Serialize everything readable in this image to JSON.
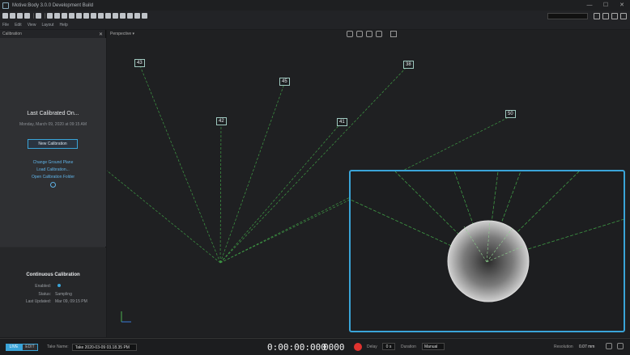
{
  "window": {
    "title": "Motive:Body 3.0.0 Development Build"
  },
  "menu": {
    "items": [
      "File",
      "Edit",
      "View",
      "Layout",
      "Help"
    ]
  },
  "calibration_panel": {
    "header": "Calibration",
    "last_calibrated_title": "Last Calibrated On...",
    "last_calibrated_date": "Monday, March 09, 2020 at 09:15 AM",
    "new_calibration_label": "New Calibration",
    "links": [
      "Change Ground Plane",
      "Load Calibration...",
      "Open Calibration Folder"
    ],
    "continuous": {
      "title": "Continuous Calibration",
      "enabled_label": "Enabled:",
      "status_label": "Status:",
      "status_value": "Sampling",
      "last_updated_label": "Last Updated:",
      "last_updated_value": "Mar 09, 09:15 PM"
    }
  },
  "viewport": {
    "view_mode": "Perspective ▾",
    "camera_ids": [
      "43",
      "45",
      "38",
      "42",
      "41",
      "50"
    ]
  },
  "bottom_bar": {
    "live_label": "LIVE",
    "edit_label": "EDIT",
    "take_name_label": "Take Name:",
    "take_name_value": "Take 2020-03-09 03.18.35 PM",
    "timecode": "0:00:00:000",
    "frames": "0000",
    "delay_label": "Delay",
    "delay_value": "0 s",
    "duration_label": "Duration",
    "duration_value": "Manual",
    "resolution_label": "Resolution",
    "resolution_value": "0.07 mm"
  },
  "colors": {
    "accent": "#3aa4d8",
    "record": "#e0332f",
    "ray": "#4caf50"
  }
}
